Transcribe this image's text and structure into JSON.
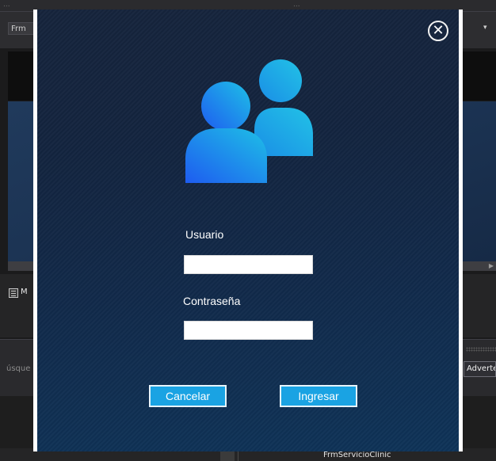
{
  "background": {
    "top_text_left": "...",
    "top_text_middle": "...",
    "tab_label": "Frm",
    "dropdown_glyph": "▾",
    "panel_label": "M",
    "search_text": "úsque",
    "warn_label": "Adverte",
    "bottom_label": "FrmServicioClinic"
  },
  "login": {
    "close_glyph": "✕",
    "username_label": "Usuario",
    "username_value": "",
    "password_label": "Contraseña",
    "password_value": "",
    "cancel_label": "Cancelar",
    "submit_label": "Ingresar",
    "icon": "users-icon",
    "colors": {
      "button": "#1aa3e3",
      "icon_gradient_start": "#1e5cf0",
      "icon_gradient_end": "#1ec0e6"
    }
  }
}
